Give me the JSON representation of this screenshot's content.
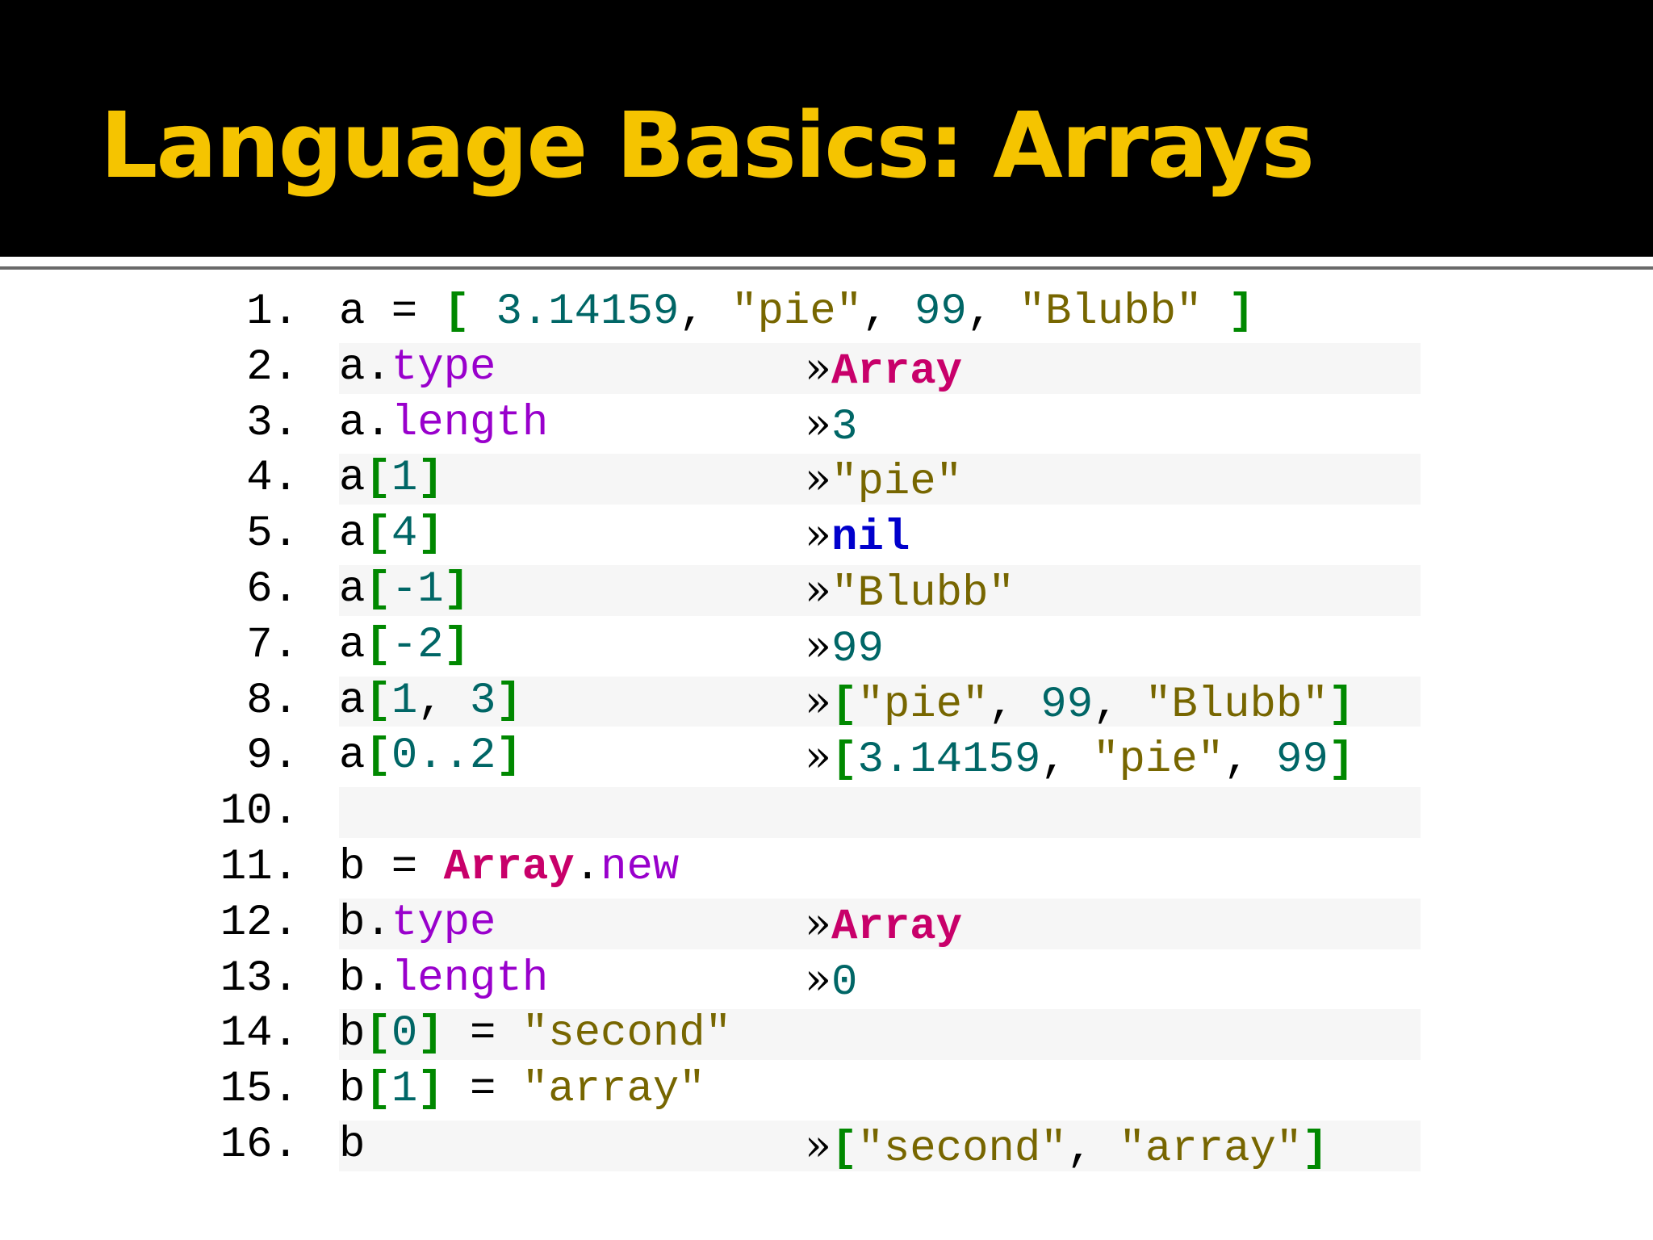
{
  "slide": {
    "title": "Language Basics: Arrays"
  },
  "colors": {
    "header_bg": "#000000",
    "title": "#f5c400",
    "keyword": "#0000cc",
    "class": "#c8006a",
    "method": "#9900cc",
    "number": "#006666",
    "string": "#776600",
    "bracket": "#008800"
  },
  "code": {
    "result_marker": "»",
    "lines": [
      {
        "n": "1.",
        "src": [
          [
            "plain",
            "a = "
          ],
          [
            "br",
            "["
          ],
          [
            "plain",
            " "
          ],
          [
            "num",
            "3.14159"
          ],
          [
            "plain",
            ", "
          ],
          [
            "str",
            "\"pie\""
          ],
          [
            "plain",
            ", "
          ],
          [
            "num",
            "99"
          ],
          [
            "plain",
            ", "
          ],
          [
            "str",
            "\"Blubb\""
          ],
          [
            "plain",
            " "
          ],
          [
            "br",
            "]"
          ]
        ],
        "result": []
      },
      {
        "n": "2.",
        "src": [
          [
            "plain",
            "a."
          ],
          [
            "meth",
            "type"
          ]
        ],
        "result": [
          [
            "cls",
            "Array"
          ]
        ]
      },
      {
        "n": "3.",
        "src": [
          [
            "plain",
            "a."
          ],
          [
            "meth",
            "length"
          ]
        ],
        "result": [
          [
            "num",
            "3"
          ]
        ]
      },
      {
        "n": "4.",
        "src": [
          [
            "plain",
            "a"
          ],
          [
            "br",
            "["
          ],
          [
            "num",
            "1"
          ],
          [
            "br",
            "]"
          ]
        ],
        "result": [
          [
            "str",
            "\"pie\""
          ]
        ]
      },
      {
        "n": "5.",
        "src": [
          [
            "plain",
            "a"
          ],
          [
            "br",
            "["
          ],
          [
            "num",
            "4"
          ],
          [
            "br",
            "]"
          ]
        ],
        "result": [
          [
            "kw",
            "nil"
          ]
        ]
      },
      {
        "n": "6.",
        "src": [
          [
            "plain",
            "a"
          ],
          [
            "br",
            "["
          ],
          [
            "num",
            "-1"
          ],
          [
            "br",
            "]"
          ]
        ],
        "result": [
          [
            "str",
            "\"Blubb\""
          ]
        ]
      },
      {
        "n": "7.",
        "src": [
          [
            "plain",
            "a"
          ],
          [
            "br",
            "["
          ],
          [
            "num",
            "-2"
          ],
          [
            "br",
            "]"
          ]
        ],
        "result": [
          [
            "num",
            "99"
          ]
        ]
      },
      {
        "n": "8.",
        "src": [
          [
            "plain",
            "a"
          ],
          [
            "br",
            "["
          ],
          [
            "num",
            "1"
          ],
          [
            "plain",
            ", "
          ],
          [
            "num",
            "3"
          ],
          [
            "br",
            "]"
          ]
        ],
        "result": [
          [
            "br",
            "["
          ],
          [
            "str",
            "\"pie\""
          ],
          [
            "plain",
            ", "
          ],
          [
            "num",
            "99"
          ],
          [
            "plain",
            ", "
          ],
          [
            "str",
            "\"Blubb\""
          ],
          [
            "br",
            "]"
          ]
        ]
      },
      {
        "n": "9.",
        "src": [
          [
            "plain",
            "a"
          ],
          [
            "br",
            "["
          ],
          [
            "num",
            "0..2"
          ],
          [
            "br",
            "]"
          ]
        ],
        "result": [
          [
            "br",
            "["
          ],
          [
            "num",
            "3.14159"
          ],
          [
            "plain",
            ", "
          ],
          [
            "str",
            "\"pie\""
          ],
          [
            "plain",
            ", "
          ],
          [
            "num",
            "99"
          ],
          [
            "br",
            "]"
          ]
        ]
      },
      {
        "n": "10.",
        "src": [],
        "result": []
      },
      {
        "n": "11.",
        "src": [
          [
            "plain",
            "b = "
          ],
          [
            "cls",
            "Array"
          ],
          [
            "plain",
            "."
          ],
          [
            "meth",
            "new"
          ]
        ],
        "result": []
      },
      {
        "n": "12.",
        "src": [
          [
            "plain",
            "b."
          ],
          [
            "meth",
            "type"
          ]
        ],
        "result": [
          [
            "cls",
            "Array"
          ]
        ]
      },
      {
        "n": "13.",
        "src": [
          [
            "plain",
            "b."
          ],
          [
            "meth",
            "length"
          ]
        ],
        "result": [
          [
            "num",
            "0"
          ]
        ]
      },
      {
        "n": "14.",
        "src": [
          [
            "plain",
            "b"
          ],
          [
            "br",
            "["
          ],
          [
            "num",
            "0"
          ],
          [
            "br",
            "]"
          ],
          [
            "plain",
            " = "
          ],
          [
            "str",
            "\"second\""
          ]
        ],
        "result": []
      },
      {
        "n": "15.",
        "src": [
          [
            "plain",
            "b"
          ],
          [
            "br",
            "["
          ],
          [
            "num",
            "1"
          ],
          [
            "br",
            "]"
          ],
          [
            "plain",
            " = "
          ],
          [
            "str",
            "\"array\""
          ]
        ],
        "result": []
      },
      {
        "n": "16.",
        "src": [
          [
            "plain",
            "b"
          ]
        ],
        "result": [
          [
            "br",
            "["
          ],
          [
            "str",
            "\"second\""
          ],
          [
            "plain",
            ", "
          ],
          [
            "str",
            "\"array\""
          ],
          [
            "br",
            "]"
          ]
        ]
      }
    ]
  }
}
